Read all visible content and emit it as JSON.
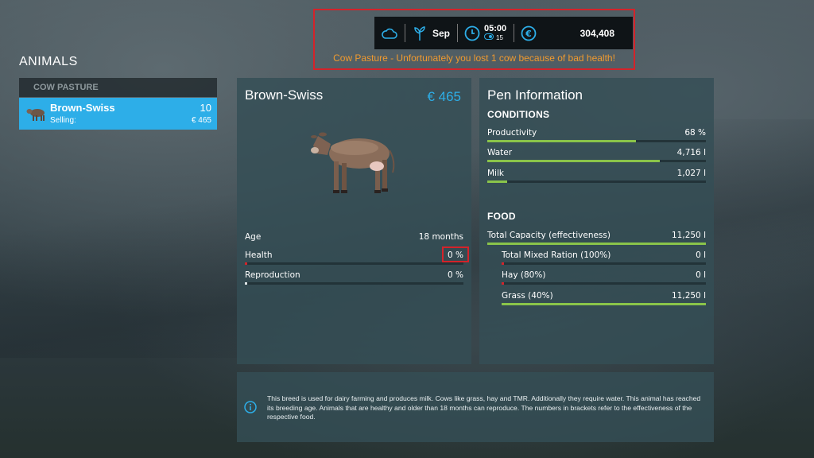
{
  "hud": {
    "weather_icon": "cloud-icon",
    "season_icon": "sprout-icon",
    "month": "Sep",
    "time": "05:00",
    "speed": "15",
    "money": "304,408",
    "accent": "#2daee8"
  },
  "notification": "Cow Pasture - Unfortunately you lost 1 cow because of bad health!",
  "left": {
    "title": "ANIMALS",
    "group": "COW PASTURE",
    "item": {
      "name": "Brown-Swiss",
      "count": "10",
      "selling_label": "Selling:",
      "selling_price": "€ 465"
    }
  },
  "animal": {
    "name": "Brown-Swiss",
    "price": "€ 465",
    "stats": [
      {
        "label": "Age",
        "value": "18 months",
        "fill": null
      },
      {
        "label": "Health",
        "value": "0 %",
        "fill": 0.01
      },
      {
        "label": "Reproduction",
        "value": "0 %",
        "fill": 0.01
      }
    ]
  },
  "pen": {
    "title": "Pen Information",
    "conditions_label": "CONDITIONS",
    "conditions": [
      {
        "label": "Productivity",
        "value": "68 %",
        "fill": 0.68
      },
      {
        "label": "Water",
        "value": "4,716 l",
        "fill": 0.79
      },
      {
        "label": "Milk",
        "value": "1,027 l",
        "fill": 0.09
      }
    ],
    "food_label": "FOOD",
    "total": {
      "label": "Total Capacity (effectiveness)",
      "value": "11,250 l",
      "fill": 1.0
    },
    "foods": [
      {
        "label": "Total Mixed Ration (100%)",
        "value": "0 l",
        "fill": 0.01
      },
      {
        "label": "Hay (80%)",
        "value": "0 l",
        "fill": 0.01
      },
      {
        "label": "Grass (40%)",
        "value": "11,250 l",
        "fill": 1.0
      }
    ]
  },
  "info": {
    "text": "This breed is used for dairy farming and produces milk. Cows like grass, hay and TMR. Additionally they require water. This animal has reached its breeding age. Animals that are healthy and older than 18 months can reproduce. The numbers in brackets refer to the effectiveness of the respective food."
  }
}
